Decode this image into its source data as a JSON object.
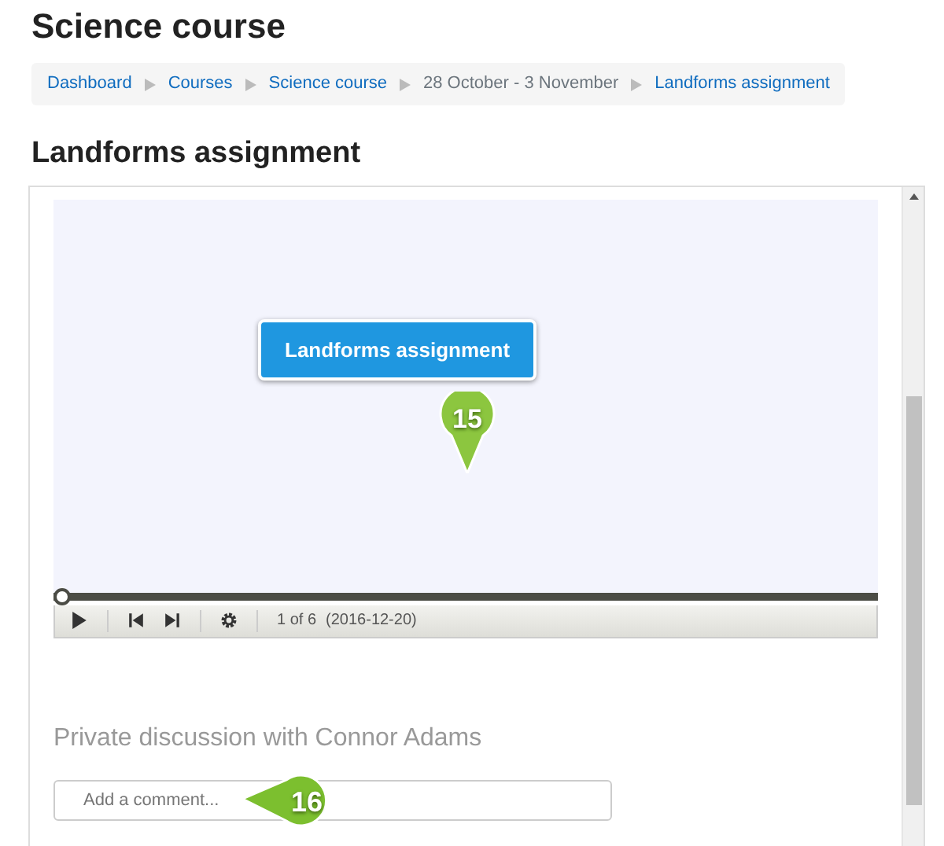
{
  "page_title": "Science course",
  "breadcrumb": [
    {
      "label": "Dashboard",
      "kind": "link"
    },
    {
      "label": "Courses",
      "kind": "link"
    },
    {
      "label": "Science course",
      "kind": "link"
    },
    {
      "label": "28 October - 3 November",
      "kind": "text"
    },
    {
      "label": "Landforms assignment",
      "kind": "link"
    }
  ],
  "heading": "Landforms assignment",
  "viewer": {
    "slide_button": "Landforms assignment",
    "pin_callout": "15",
    "player": {
      "level": 0,
      "position": "1 of 6",
      "date": "(2016-12-20)"
    }
  },
  "discussion": {
    "title": "Private discussion with Connor Adams",
    "comment": {
      "placeholder": "Add a comment..."
    },
    "pin_callout": "16"
  }
}
